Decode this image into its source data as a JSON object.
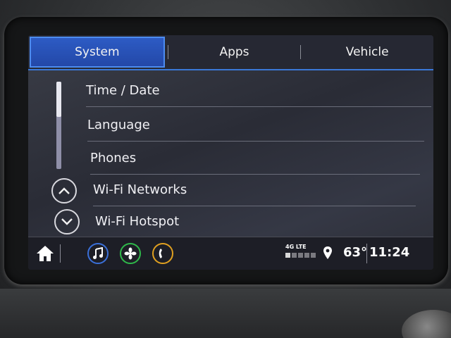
{
  "tabs": [
    {
      "label": "System",
      "active": true
    },
    {
      "label": "Apps",
      "active": false
    },
    {
      "label": "Vehicle",
      "active": false
    }
  ],
  "settings_list": {
    "items": [
      {
        "label": "Time / Date"
      },
      {
        "label": "Language"
      },
      {
        "label": "Phones"
      },
      {
        "label": "Wi-Fi Networks"
      },
      {
        "label": "Wi-Fi Hotspot"
      }
    ],
    "scroll_up_icon": "chevron-up-icon",
    "scroll_down_icon": "chevron-down-icon",
    "scroll_position": 0.0,
    "scroll_visible_fraction": 0.4
  },
  "status_bar": {
    "home_icon": "home-icon",
    "apps": [
      {
        "name": "audio",
        "icon": "music-note-icon",
        "ring_color": "#3a6fd8"
      },
      {
        "name": "climate",
        "icon": "fan-icon",
        "ring_color": "#2fb84a"
      },
      {
        "name": "phone",
        "icon": "phone-icon",
        "ring_color": "#e0a020"
      }
    ],
    "network": "4G LTE",
    "signal_bars": 1,
    "location_icon": "location-pin-icon",
    "temperature": "63°",
    "time": "11:24"
  },
  "colors": {
    "accent": "#2d5bc4",
    "tab_underline": "#3a78d8"
  }
}
